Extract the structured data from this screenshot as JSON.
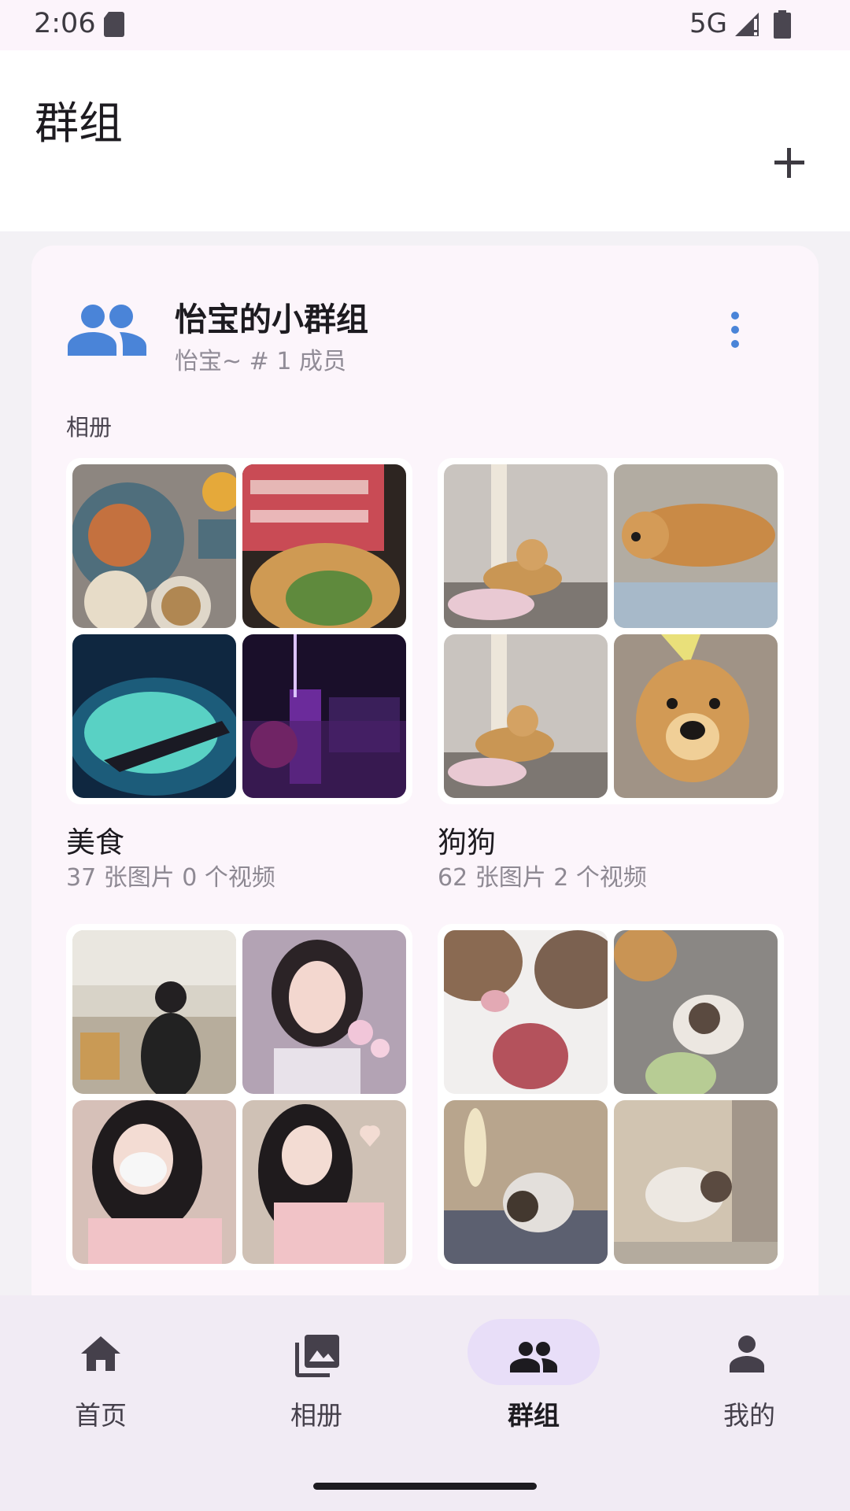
{
  "status": {
    "time": "2:06",
    "network": "5G"
  },
  "header": {
    "title": "群组",
    "add_icon": "plus-icon"
  },
  "group": {
    "name": "怡宝的小群组",
    "meta": "怡宝~ # 1 成员",
    "section_label": "相册"
  },
  "albums": [
    {
      "name": "美食",
      "count": "37 张图片 0 个视频"
    },
    {
      "name": "狗狗",
      "count": "62 张图片 2 个视频"
    },
    {
      "name": "",
      "count": ""
    },
    {
      "name": "",
      "count": ""
    }
  ],
  "nav": [
    {
      "label": "首页",
      "icon": "home-icon"
    },
    {
      "label": "相册",
      "icon": "photo-library-icon"
    },
    {
      "label": "群组",
      "icon": "group-icon"
    },
    {
      "label": "我的",
      "icon": "person-icon"
    }
  ],
  "colors": {
    "accent": "#4a84d8",
    "nav_active": "#e8def8",
    "card": "#fcf5fb"
  }
}
